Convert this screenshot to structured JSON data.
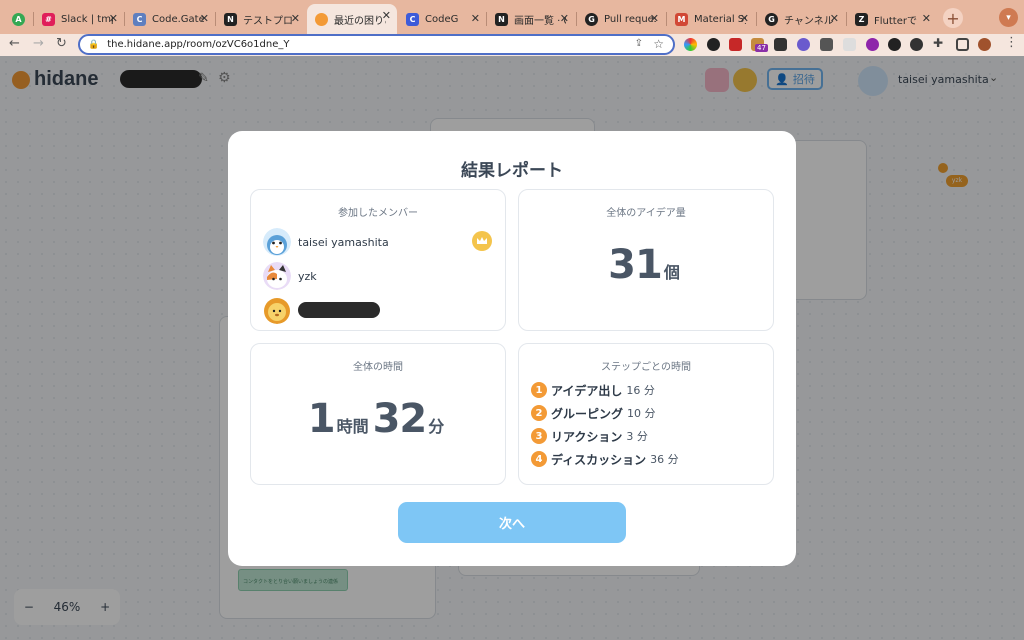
{
  "browser": {
    "tabs": [
      {
        "title": "",
        "favicon": "A",
        "color": "#34a853"
      },
      {
        "title": "Slack | tmp",
        "favicon": "#",
        "color": "#e01e5a"
      },
      {
        "title": "Code.Gate",
        "favicon": "C",
        "color": "#5f7fbf"
      },
      {
        "title": "テストプロ",
        "favicon": "N",
        "color": "#222222"
      },
      {
        "title": "最近の困りご",
        "favicon": "●",
        "color": "#f39a36",
        "active": true
      },
      {
        "title": "CodeG",
        "favicon": "C",
        "color": "#3d5bd9"
      },
      {
        "title": "画面一覧 · C",
        "favicon": "N",
        "color": "#222222"
      },
      {
        "title": "Pull reques",
        "favicon": "G",
        "color": "#222222"
      },
      {
        "title": "Material Sy",
        "favicon": "M",
        "color": "#d14836"
      },
      {
        "title": "チャンネル",
        "favicon": "G",
        "color": "#222222"
      },
      {
        "title": "Flutterで",
        "favicon": "Z",
        "color": "#222222"
      }
    ],
    "new_tab": "+",
    "url": "the.hidane.app/room/ozVC6o1dne_Y",
    "extension_badge": "47"
  },
  "app": {
    "logo_text": "hidane",
    "invite_label": "招待",
    "user_name": "taisei yamashita",
    "zoom_level": "46%",
    "zoom_minus": "−",
    "zoom_plus": "+",
    "bg_pill": "yzk",
    "bg_sticky_text": "コンタクトをとり合い願いましょうの連係"
  },
  "modal": {
    "title": "結果レポート",
    "members": {
      "title": "参加したメンバー",
      "items": [
        {
          "name": "taisei yamashita",
          "avatar": "penguin-avatar",
          "crown": true
        },
        {
          "name": "yzk",
          "avatar": "cat-avatar"
        },
        {
          "name": "",
          "avatar": "lion-avatar",
          "redacted": true
        }
      ]
    },
    "ideas": {
      "title": "全体のアイデア量",
      "value": "31",
      "unit": "個"
    },
    "total_time": {
      "title": "全体の時間",
      "hours": "1",
      "hours_unit": "時間",
      "minutes": "32",
      "minutes_unit": "分"
    },
    "steps": {
      "title": "ステップごとの時間",
      "items": [
        {
          "num": "1",
          "label": "アイデア出し",
          "time": "16 分"
        },
        {
          "num": "2",
          "label": "グルーピング",
          "time": "10 分"
        },
        {
          "num": "3",
          "label": "リアクション",
          "time": "3 分"
        },
        {
          "num": "4",
          "label": "ディスカッション",
          "time": "36 分"
        }
      ]
    },
    "next_label": "次へ"
  }
}
